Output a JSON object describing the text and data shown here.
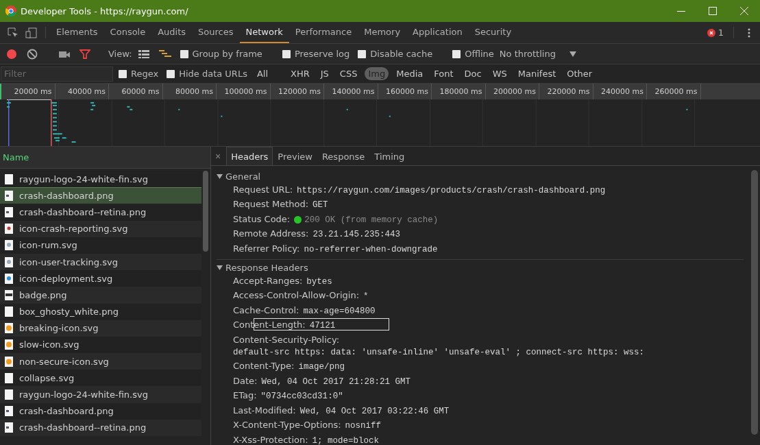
{
  "window": {
    "title": "Developer Tools - https://raygun.com/"
  },
  "panel_tabs": [
    {
      "label": "Elements",
      "selected": false
    },
    {
      "label": "Console",
      "selected": false
    },
    {
      "label": "Audits",
      "selected": false
    },
    {
      "label": "Sources",
      "selected": false
    },
    {
      "label": "Network",
      "selected": true
    },
    {
      "label": "Performance",
      "selected": false
    },
    {
      "label": "Memory",
      "selected": false
    },
    {
      "label": "Application",
      "selected": false
    },
    {
      "label": "Security",
      "selected": false
    }
  ],
  "error_count": "1",
  "toolbar": {
    "recording": true,
    "view_label": "View:",
    "options": [
      {
        "label": "Group by frame",
        "checked": false
      },
      {
        "label": "Preserve log",
        "checked": false
      },
      {
        "label": "Disable cache",
        "checked": false
      },
      {
        "label": "Offline",
        "checked": false
      }
    ],
    "throttling": "No throttling"
  },
  "filter": {
    "placeholder": "Filter",
    "options": [
      {
        "label": "Regex",
        "checked": false
      },
      {
        "label": "Hide data URLs",
        "checked": false
      }
    ],
    "types": [
      {
        "label": "All",
        "selected": false
      },
      {
        "label": "XHR",
        "selected": false
      },
      {
        "label": "JS",
        "selected": false
      },
      {
        "label": "CSS",
        "selected": false
      },
      {
        "label": "Img",
        "selected": true
      },
      {
        "label": "Media",
        "selected": false
      },
      {
        "label": "Font",
        "selected": false
      },
      {
        "label": "Doc",
        "selected": false
      },
      {
        "label": "WS",
        "selected": false
      },
      {
        "label": "Manifest",
        "selected": false
      },
      {
        "label": "Other",
        "selected": false
      }
    ]
  },
  "timeline": {
    "ticks": [
      "20000 ms",
      "40000 ms",
      "60000 ms",
      "80000 ms",
      "100000 ms",
      "120000 ms",
      "140000 ms",
      "160000 ms",
      "180000 ms",
      "200000 ms",
      "220000 ms",
      "240000 ms",
      "260000 ms"
    ]
  },
  "requests": {
    "column": "Name",
    "rows": [
      {
        "name": "raygun-logo-24-white-fin.svg",
        "kind": "blank",
        "selected": false
      },
      {
        "name": "crash-dashboard.png",
        "kind": "image",
        "selected": true
      },
      {
        "name": "crash-dashboard--retina.png",
        "kind": "image",
        "selected": false
      },
      {
        "name": "icon-crash-reporting.svg",
        "kind": "red",
        "selected": false
      },
      {
        "name": "icon-rum.svg",
        "kind": "grey",
        "selected": false
      },
      {
        "name": "icon-user-tracking.svg",
        "kind": "grey",
        "selected": false
      },
      {
        "name": "icon-deployment.svg",
        "kind": "blue",
        "selected": false
      },
      {
        "name": "badge.png",
        "kind": "badge",
        "selected": false
      },
      {
        "name": "box_ghosty_white.png",
        "kind": "blank",
        "selected": false
      },
      {
        "name": "breaking-icon.svg",
        "kind": "orange",
        "selected": false
      },
      {
        "name": "slow-icon.svg",
        "kind": "orange",
        "selected": false
      },
      {
        "name": "non-secure-icon.svg",
        "kind": "orange",
        "selected": false
      },
      {
        "name": "collapse.svg",
        "kind": "blank",
        "selected": false
      },
      {
        "name": "raygun-logo-24-white-fin.svg",
        "kind": "blank",
        "selected": false
      },
      {
        "name": "crash-dashboard.png",
        "kind": "image",
        "selected": false
      },
      {
        "name": "crash-dashboard--retina.png",
        "kind": "image",
        "selected": false
      }
    ]
  },
  "details": {
    "close": "×",
    "tabs": [
      {
        "label": "Headers",
        "selected": true
      },
      {
        "label": "Preview",
        "selected": false
      },
      {
        "label": "Response",
        "selected": false
      },
      {
        "label": "Timing",
        "selected": false
      }
    ],
    "sections": [
      {
        "title": "General",
        "expanded": true,
        "headers": [
          {
            "name": "Request URL:",
            "value": "https://raygun.com/images/products/crash/crash-dashboard.png",
            "kind": "plain"
          },
          {
            "name": "Request Method:",
            "value": "GET",
            "kind": "plain"
          },
          {
            "name": "Status Code:",
            "value": "200 OK (from memory cache)",
            "kind": "status"
          },
          {
            "name": "Remote Address:",
            "value": "23.21.145.235:443",
            "kind": "plain"
          },
          {
            "name": "Referrer Policy:",
            "value": "no-referrer-when-downgrade",
            "kind": "plain"
          }
        ]
      },
      {
        "title": "Response Headers",
        "expanded": true,
        "headers": [
          {
            "name": "Accept-Ranges:",
            "value": "bytes",
            "kind": "plain"
          },
          {
            "name": "Access-Control-Allow-Origin:",
            "value": "*",
            "kind": "plain"
          },
          {
            "name": "Cache-Control:",
            "value": "max-age=604800",
            "kind": "plain"
          },
          {
            "name": "Content-Length:",
            "value": "47121",
            "kind": "outlined"
          },
          {
            "name": "Content-Security-Policy:",
            "value": "default-src https: data: 'unsafe-inline' 'unsafe-eval' ; connect-src https: wss:",
            "kind": "plain"
          },
          {
            "name": "Content-Type:",
            "value": "image/png",
            "kind": "plain"
          },
          {
            "name": "Date:",
            "value": "Wed, 04 Oct 2017 21:28:21 GMT",
            "kind": "plain"
          },
          {
            "name": "ETag:",
            "value": "\"0734cc03cd31:0\"",
            "kind": "plain"
          },
          {
            "name": "Last-Modified:",
            "value": "Wed, 04 Oct 2017 03:22:46 GMT",
            "kind": "plain"
          },
          {
            "name": "X-Content-Type-Options:",
            "value": "nosniff",
            "kind": "plain"
          },
          {
            "name": "X-Xss-Protection:",
            "value": "1; mode=block",
            "kind": "plain"
          }
        ]
      }
    ]
  }
}
